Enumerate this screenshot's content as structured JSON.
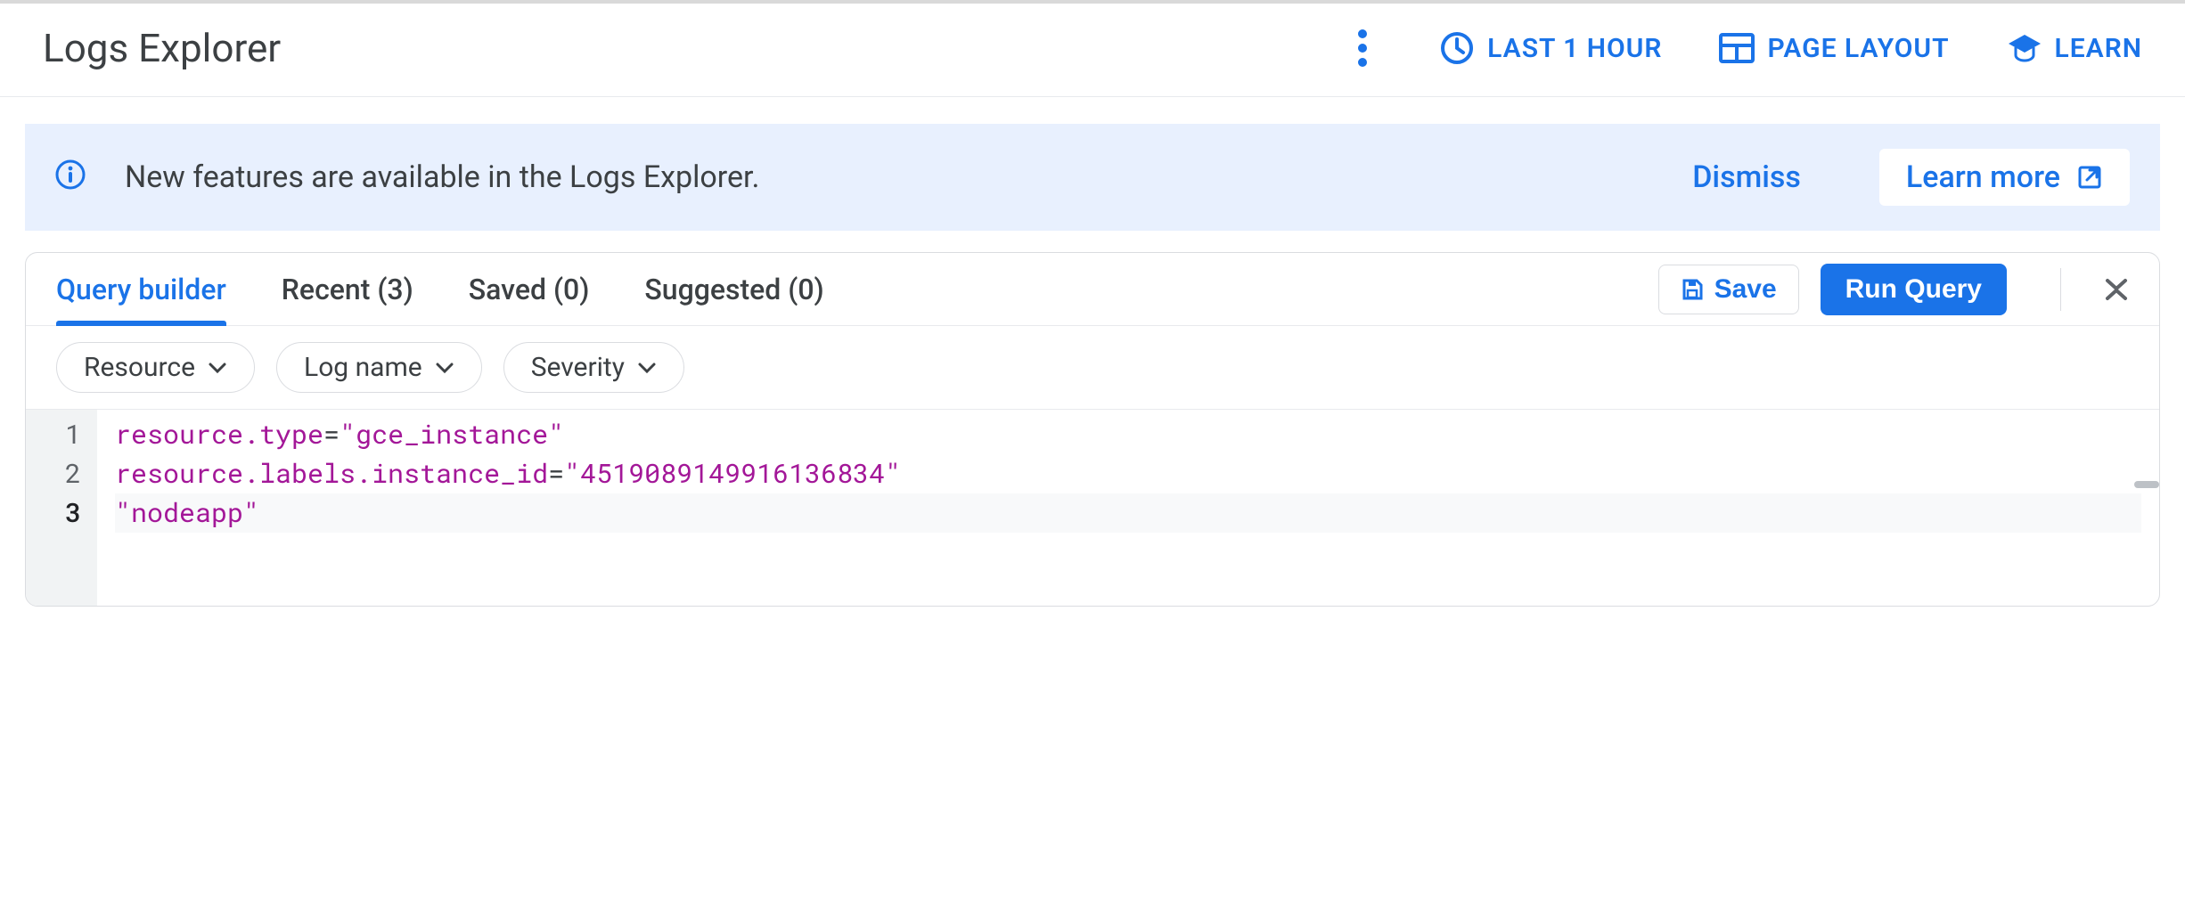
{
  "header": {
    "title": "Logs Explorer",
    "time_range_label": "LAST 1 HOUR",
    "page_layout_label": "PAGE LAYOUT",
    "learn_label": "LEARN"
  },
  "banner": {
    "message": "New features are available in the Logs Explorer.",
    "dismiss_label": "Dismiss",
    "learn_more_label": "Learn more"
  },
  "query_panel": {
    "tabs": [
      {
        "label": "Query builder",
        "active": true
      },
      {
        "label": "Recent (3)"
      },
      {
        "label": "Saved (0)"
      },
      {
        "label": "Suggested (0)"
      }
    ],
    "save_label": "Save",
    "run_label": "Run Query",
    "chips": [
      {
        "label": "Resource"
      },
      {
        "label": "Log name"
      },
      {
        "label": "Severity"
      }
    ],
    "editor": {
      "current_line": 3,
      "lines": [
        {
          "key": "resource.type",
          "value": "gce_instance"
        },
        {
          "key": "resource.labels.instance_id",
          "value": "4519089149916136834"
        },
        {
          "value_only": "nodeapp"
        }
      ]
    }
  }
}
